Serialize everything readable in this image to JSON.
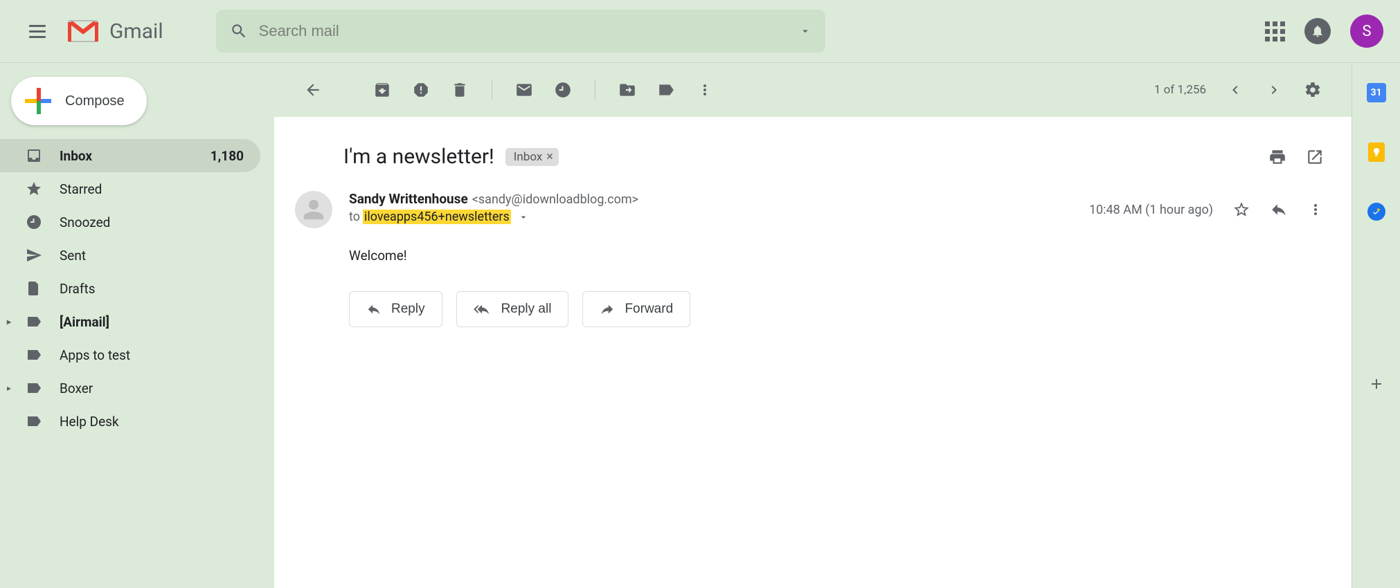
{
  "header": {
    "app_name": "Gmail",
    "search_placeholder": "Search mail",
    "avatar_letter": "S"
  },
  "compose_label": "Compose",
  "sidebar": [
    {
      "label": "Inbox",
      "count": "1,180",
      "active": true,
      "bold": true
    },
    {
      "label": "Starred"
    },
    {
      "label": "Snoozed"
    },
    {
      "label": "Sent"
    },
    {
      "label": "Drafts"
    },
    {
      "label": "[Airmail]",
      "bold": true,
      "expand": true
    },
    {
      "label": "Apps to test"
    },
    {
      "label": "Boxer",
      "expand": true
    },
    {
      "label": "Help Desk"
    }
  ],
  "toolbar": {
    "position": "1 of 1,256"
  },
  "message": {
    "subject": "I'm a newsletter!",
    "label_chip": "Inbox",
    "sender_name": "Sandy Writtenhouse",
    "sender_email": "<sandy@idownloadblog.com>",
    "to_prefix": "to",
    "to_highlight": "iloveapps456+newsletters",
    "timestamp": "10:48 AM (1 hour ago)",
    "body": "Welcome!",
    "reply_label": "Reply",
    "reply_all_label": "Reply all",
    "forward_label": "Forward"
  },
  "rail": {
    "calendar_day": "31"
  }
}
